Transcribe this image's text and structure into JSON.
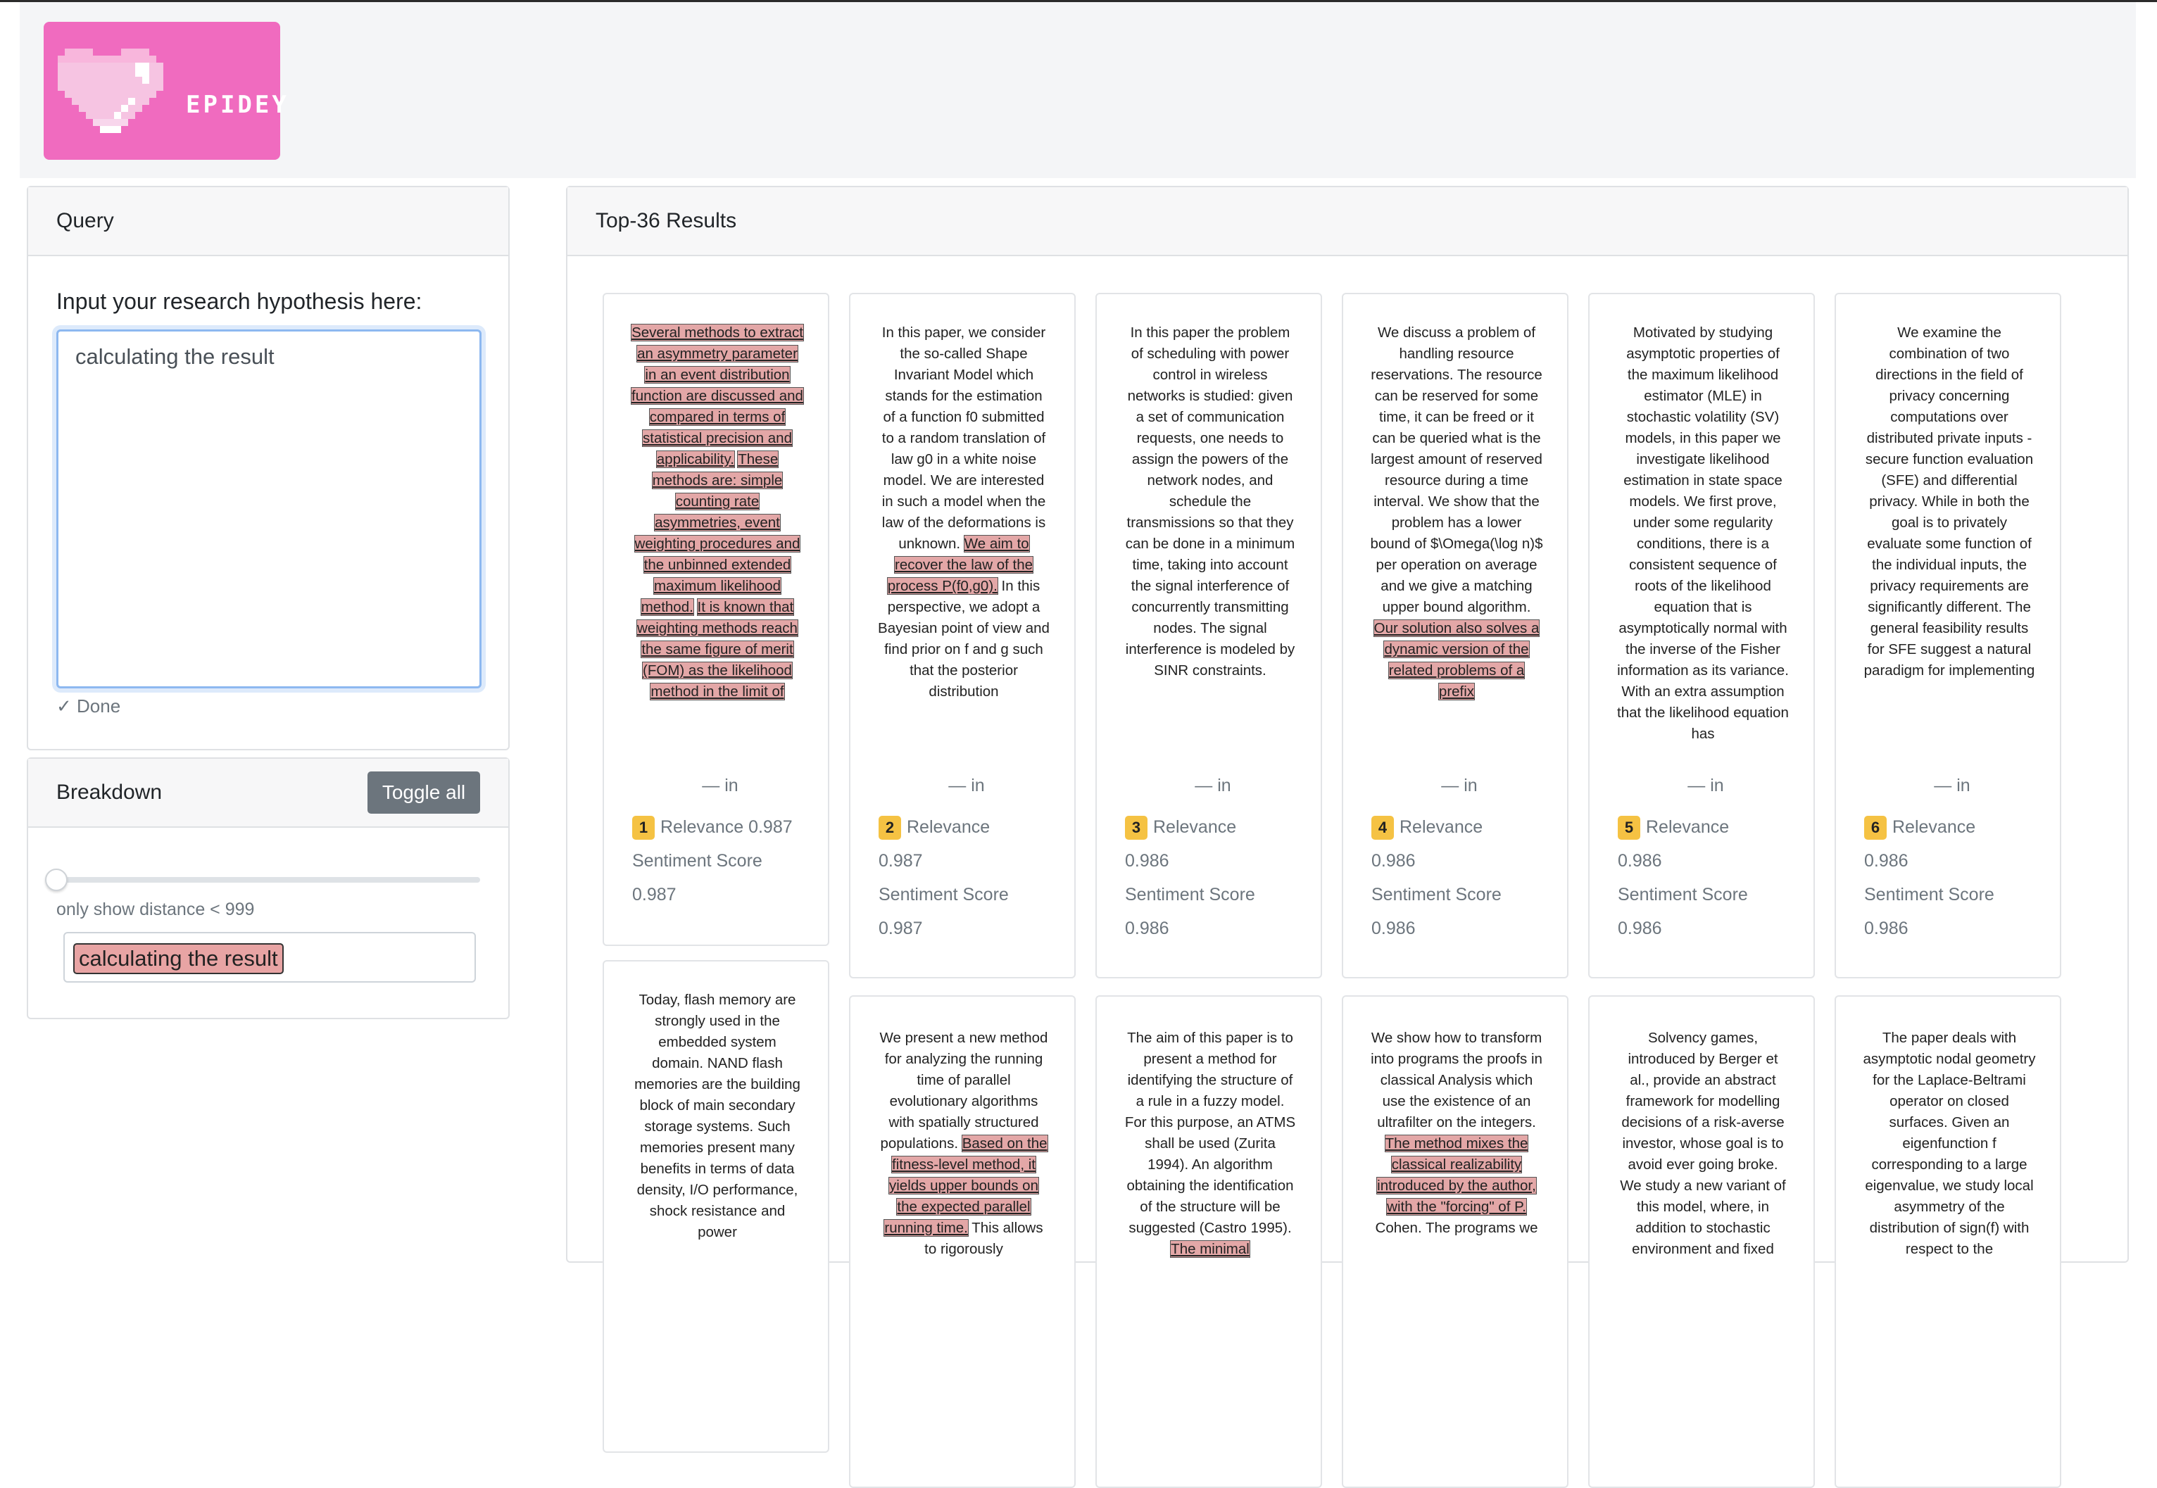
{
  "brand": {
    "name": "EPIDEY"
  },
  "query": {
    "title": "Query",
    "label": "Input your research hypothesis here:",
    "value": "calculating the result",
    "status": "✓ Done"
  },
  "breakdown": {
    "title": "Breakdown",
    "toggle_label": "Toggle all",
    "slider_value": 999,
    "slider_caption": "only show distance < 999",
    "chip": "calculating the result"
  },
  "results": {
    "title": "Top-36 Results",
    "items": [
      {
        "rank": "1",
        "relevance_label": "Relevance 0.987",
        "relevance_value": "",
        "sentiment_label": "Sentiment Score",
        "sentiment_value": "0.987",
        "in": "— in",
        "segments": [
          {
            "text": "Several methods to extract an asymmetry parameter in an event distribution function are discussed and compared in terms of statistical precision and applicability.",
            "hl": true
          },
          {
            "text": " ",
            "hl": false
          },
          {
            "text": "These methods are: simple counting rate asymmetries, event weighting procedures and the unbinned extended maximum likelihood method.",
            "hl": true
          },
          {
            "text": " ",
            "hl": false
          },
          {
            "text": "It is known that weighting methods reach the same figure of merit (FOM) as the likelihood method in the limit of",
            "hl": true
          }
        ]
      },
      {
        "rank": "2",
        "relevance_label": "Relevance",
        "relevance_value": "0.987",
        "sentiment_label": "Sentiment Score",
        "sentiment_value": "0.987",
        "in": "— in",
        "segments": [
          {
            "text": "In this paper, we consider the so-called Shape Invariant Model which stands for the estimation of a function f0 submitted to a random translation of law g0 in a white noise model. We are interested in such a model when the law of the deformations is unknown. ",
            "hl": false
          },
          {
            "text": "We aim to recover the law of the process P(f0,g0).",
            "hl": true
          },
          {
            "text": " In this perspective, we adopt a Bayesian point of view and find prior on f and g such that the posterior distribution",
            "hl": false
          }
        ]
      },
      {
        "rank": "3",
        "relevance_label": "Relevance",
        "relevance_value": "0.986",
        "sentiment_label": "Sentiment Score",
        "sentiment_value": "0.986",
        "in": "— in",
        "segments": [
          {
            "text": "In this paper the problem of scheduling with power control in wireless networks is studied: given a set of communication requests, one needs to assign the powers of the network nodes, and schedule the transmissions so that they can be done in a minimum time, taking into account the signal interference of concurrently transmitting nodes. The signal interference is modeled by SINR constraints.",
            "hl": false
          }
        ]
      },
      {
        "rank": "4",
        "relevance_label": "Relevance",
        "relevance_value": "0.986",
        "sentiment_label": "Sentiment Score",
        "sentiment_value": "0.986",
        "in": "— in",
        "segments": [
          {
            "text": "We discuss a problem of handling resource reservations. The resource can be reserved for some time, it can be freed or it can be queried what is the largest amount of reserved resource during a time interval. We show that the problem has a lower bound of $\\Omega(\\log n)$ per operation on average and we give a matching upper bound algorithm. ",
            "hl": false
          },
          {
            "text": "Our solution also solves a dynamic version of the related problems of a prefix",
            "hl": true
          }
        ]
      },
      {
        "rank": "5",
        "relevance_label": "Relevance",
        "relevance_value": "0.986",
        "sentiment_label": "Sentiment Score",
        "sentiment_value": "0.986",
        "in": "— in",
        "segments": [
          {
            "text": "Motivated by studying asymptotic properties of the maximum likelihood estimator (MLE) in stochastic volatility (SV) models, in this paper we investigate likelihood estimation in state space models. We first prove, under some regularity conditions, there is a consistent sequence of roots of the likelihood equation that is asymptotically normal with the inverse of the Fisher information as its variance. With an extra assumption that the likelihood equation has",
            "hl": false
          }
        ]
      },
      {
        "rank": "6",
        "relevance_label": "Relevance",
        "relevance_value": "0.986",
        "sentiment_label": "Sentiment Score",
        "sentiment_value": "0.986",
        "in": "— in",
        "segments": [
          {
            "text": "We examine the combination of two directions in the field of privacy concerning computations over distributed private inputs - secure function evaluation (SFE) and differential privacy. While in both the goal is to privately evaluate some function of the individual inputs, the privacy requirements are significantly different. The general feasibility results for SFE suggest a natural paradigm for implementing",
            "hl": false
          }
        ]
      },
      {
        "segments": [
          {
            "text": "Today, flash memory are strongly used in the embedded system domain. NAND flash memories are the building block of main secondary storage systems. Such memories present many benefits in terms of data density, I/O performance, shock resistance and power",
            "hl": false
          }
        ]
      },
      {
        "segments": [
          {
            "text": "We present a new method for analyzing the running time of parallel evolutionary algorithms with spatially structured populations. ",
            "hl": false
          },
          {
            "text": "Based on the fitness-level method, it yields upper bounds on the expected parallel running time.",
            "hl": true
          },
          {
            "text": " This allows to rigorously",
            "hl": false
          }
        ]
      },
      {
        "segments": [
          {
            "text": "The aim of this paper is to present a method for identifying the structure of a rule in a fuzzy model. For this purpose, an ATMS shall be used (Zurita 1994). An algorithm obtaining the identification of the structure will be suggested (Castro 1995). ",
            "hl": false
          },
          {
            "text": "The minimal",
            "hl": true
          }
        ]
      },
      {
        "segments": [
          {
            "text": "We show how to transform into programs the proofs in classical Analysis which use the existence of an ultrafilter on the integers. ",
            "hl": false
          },
          {
            "text": "The method mixes the classical realizability introduced by the author, with the \"forcing\" of P.",
            "hl": true
          },
          {
            "text": " Cohen. The programs we",
            "hl": false
          }
        ]
      },
      {
        "segments": [
          {
            "text": "Solvency games, introduced by Berger et al., provide an abstract framework for modelling decisions of a risk-averse investor, whose goal is to avoid ever going broke. We study a new variant of this model, where, in addition to stochastic environment and fixed",
            "hl": false
          }
        ]
      },
      {
        "segments": [
          {
            "text": "The paper deals with asymptotic nodal geometry for the Laplace-Beltrami operator on closed surfaces. Given an eigenfunction f corresponding to a large eigenvalue, we study local asymmetry of the distribution of sign(f) with respect to the",
            "hl": false
          }
        ]
      }
    ]
  }
}
